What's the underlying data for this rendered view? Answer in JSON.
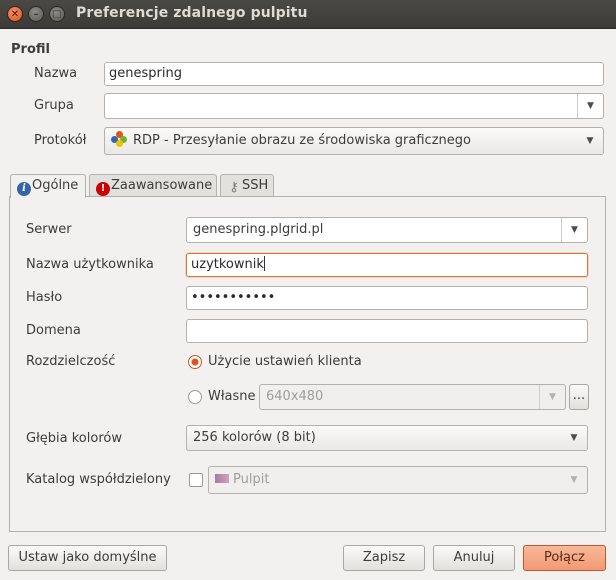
{
  "window": {
    "title": "Preferencje zdalnego pulpitu",
    "close_glyph": "✕",
    "minimize_glyph": "–",
    "maximize_glyph": "□"
  },
  "profile": {
    "section_label": "Profil",
    "name_label": "Nazwa",
    "name_value": "genespring",
    "group_label": "Grupa",
    "group_value": "",
    "protocol_label": "Protokół",
    "protocol_value": "RDP - Przesyłanie obrazu ze środowiska graficznego",
    "protocol_icon": "rdp-protocol-icon"
  },
  "tabs": [
    {
      "label": "Ogólne",
      "icon": "info-icon",
      "active": true
    },
    {
      "label": "Zaawansowane",
      "icon": "warning-icon",
      "active": false
    },
    {
      "label": "SSH",
      "icon": "key-icon",
      "active": false
    }
  ],
  "general": {
    "server_label": "Serwer",
    "server_value": "genespring.plgrid.pl",
    "username_label": "Nazwa użytkownika",
    "username_value": "uzytkownik",
    "password_label": "Hasło",
    "password_value": "•••••••••••",
    "domain_label": "Domena",
    "domain_value": "",
    "resolution_label": "Rozdzielczość",
    "resolution_client_option": "Użycie ustawień klienta",
    "resolution_custom_option": "Własne",
    "resolution_custom_value": "640x480",
    "resolution_more_button": "...",
    "color_depth_label": "Głębia kolorów",
    "color_depth_value": "256 kolorów (8 bit)",
    "shared_folder_label": "Katalog współdzielony",
    "shared_folder_value": "Pulpit"
  },
  "buttons": {
    "set_default": "Ustaw jako domyślne",
    "save": "Zapisz",
    "cancel": "Anuluj",
    "connect": "Połącz"
  },
  "colors": {
    "titlebar": "#3c3b37",
    "accent": "#e0531e",
    "focus_border": "#e0782b",
    "connect_button": "#f29a74"
  },
  "state": {
    "resolution_selected": "client",
    "shared_folder_enabled": false,
    "focused_field": "username"
  }
}
